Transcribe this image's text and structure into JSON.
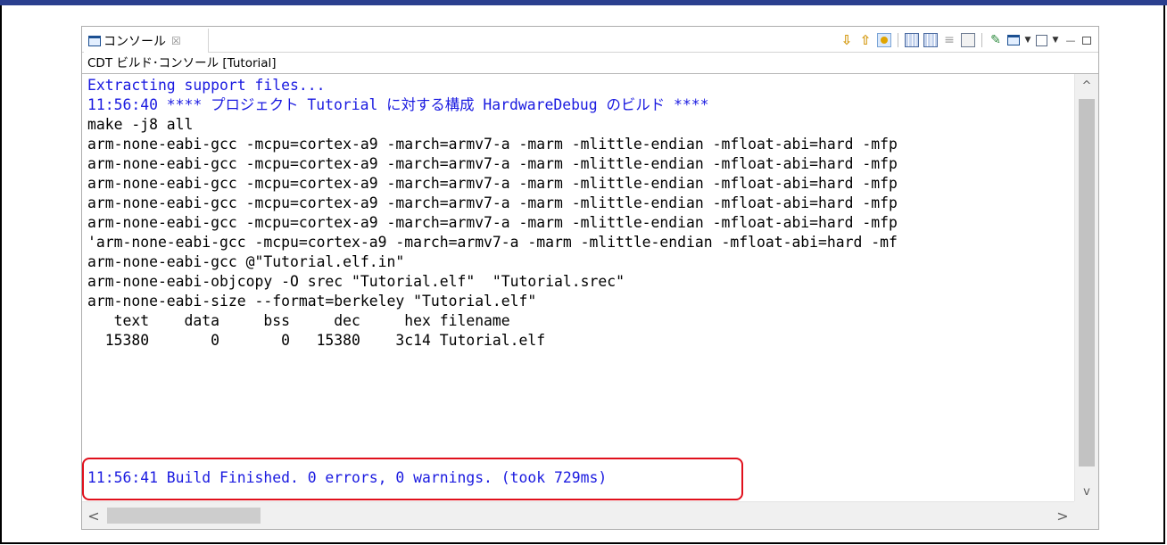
{
  "tab": {
    "label": "コンソール",
    "close_glyph": "☒",
    "icon": "console-icon"
  },
  "toolbar": {
    "buttons": [
      {
        "name": "next-error-icon",
        "glyph": "⇩"
      },
      {
        "name": "previous-error-icon",
        "glyph": "⇧"
      },
      {
        "name": "scroll-lock-icon",
        "glyph": ""
      },
      {
        "name": "show-console-on-output-icon",
        "glyph": ""
      },
      {
        "name": "show-console-on-error-icon",
        "glyph": ""
      },
      {
        "name": "word-wrap-icon",
        "glyph": "≡"
      },
      {
        "name": "clear-console-icon",
        "glyph": ""
      },
      {
        "name": "pin-console-icon",
        "glyph": "📌"
      },
      {
        "name": "display-selected-console-icon",
        "glyph": ""
      },
      {
        "name": "open-console-icon",
        "glyph": ""
      },
      {
        "name": "minimize-icon",
        "glyph": "▭"
      },
      {
        "name": "maximize-icon",
        "glyph": "□"
      }
    ],
    "caret_glyph": "▼",
    "min_glyph": "—"
  },
  "subtitle": "CDT ビルド･コンソール [Tutorial]",
  "output": {
    "lines": [
      {
        "text": "Extracting support files...",
        "kind": "info"
      },
      {
        "text": "11:56:40 **** プロジェクト Tutorial に対する構成 HardwareDebug のビルド ****",
        "kind": "info"
      },
      {
        "text": "make -j8 all",
        "kind": "normal"
      },
      {
        "text": "arm-none-eabi-gcc -mcpu=cortex-a9 -march=armv7-a -marm -mlittle-endian -mfloat-abi=hard -mfp",
        "kind": "normal"
      },
      {
        "text": "arm-none-eabi-gcc -mcpu=cortex-a9 -march=armv7-a -marm -mlittle-endian -mfloat-abi=hard -mfp",
        "kind": "normal"
      },
      {
        "text": "arm-none-eabi-gcc -mcpu=cortex-a9 -march=armv7-a -marm -mlittle-endian -mfloat-abi=hard -mfp",
        "kind": "normal"
      },
      {
        "text": "arm-none-eabi-gcc -mcpu=cortex-a9 -march=armv7-a -marm -mlittle-endian -mfloat-abi=hard -mfp",
        "kind": "normal"
      },
      {
        "text": "arm-none-eabi-gcc -mcpu=cortex-a9 -march=armv7-a -marm -mlittle-endian -mfloat-abi=hard -mfp",
        "kind": "normal"
      },
      {
        "text": "'arm-none-eabi-gcc -mcpu=cortex-a9 -march=armv7-a -marm -mlittle-endian -mfloat-abi=hard -mf",
        "kind": "normal"
      },
      {
        "text": "arm-none-eabi-gcc @\"Tutorial.elf.in\"",
        "kind": "normal"
      },
      {
        "text": "arm-none-eabi-objcopy -O srec \"Tutorial.elf\"  \"Tutorial.srec\"",
        "kind": "normal"
      },
      {
        "text": "arm-none-eabi-size --format=berkeley \"Tutorial.elf\"",
        "kind": "normal"
      },
      {
        "text": "   text    data     bss     dec     hex filename",
        "kind": "normal"
      },
      {
        "text": "  15380       0       0   15380    3c14 Tutorial.elf",
        "kind": "normal"
      },
      {
        "text": "",
        "kind": "normal"
      },
      {
        "text": "11:56:41 Build Finished. 0 errors, 0 warnings. (took 729ms)",
        "kind": "info"
      }
    ]
  },
  "scroll": {
    "up_glyph": "^",
    "down_glyph": "v",
    "left_glyph": "<",
    "right_glyph": ">"
  },
  "colors": {
    "info_text": "#1a1ae0",
    "highlight_border": "#e0101c",
    "top_rule": "#2b3f8f"
  }
}
